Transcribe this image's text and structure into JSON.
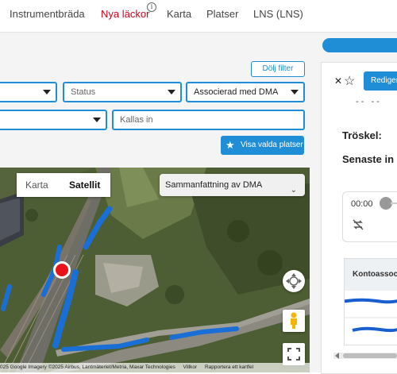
{
  "nav": {
    "items": [
      "Instrumentbräda",
      "Nya läckor",
      "Karta",
      "Platser",
      "LNS (LNS)"
    ],
    "info_symbol": "i"
  },
  "filters": {
    "hide_label": "Dölj filter",
    "status_placeholder": "Status",
    "dma_value": "Associerad med DMA",
    "called_placeholder": "Kallas in",
    "show_selected_label": "Visa valda platser"
  },
  "map": {
    "type_options": [
      "Karta",
      "Satellit"
    ],
    "selected_type": "Satellit",
    "dma_summary_label": "Sammanfattning av DMA",
    "attribution": [
      "025 Google Imagery ©2025 Airbus, Lantmäteriet/Metria, Maxar Technologies",
      "Villkor",
      "Rapportera ett kartfel"
    ],
    "marker_color": "#e8121b",
    "line_color": "#1a6fd6"
  },
  "panel": {
    "close_symbol": "✕",
    "star_symbol": "☆",
    "edit_label": "Redigera",
    "dash_text": "- -   - -",
    "threshold_label": "Tröskel:",
    "latest_label": "Senaste in",
    "time_label": "00:00",
    "column_header": "Kontoassociering"
  },
  "colors": {
    "accent": "#1f8ed6",
    "active_nav": "#d0021b"
  }
}
